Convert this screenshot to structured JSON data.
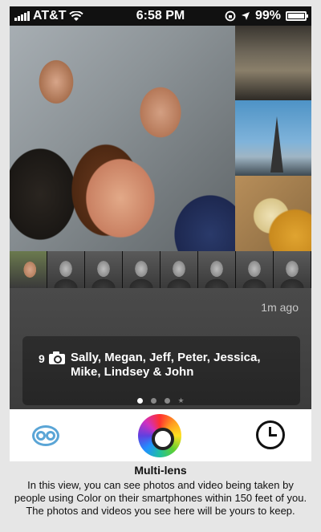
{
  "status_bar": {
    "carrier": "AT&T",
    "time": "6:58 PM",
    "battery": "99%",
    "battery_level": 0.99,
    "icons": [
      "signal-icon",
      "wifi-icon",
      "rotation-lock-icon",
      "location-arrow-icon",
      "battery-icon"
    ]
  },
  "photo_view": {
    "main_photo": "group-selfie-photo",
    "side_thumbnails": [
      "market-hall-photo",
      "transamerica-pyramid-photo",
      "cheese-wheels-photo"
    ],
    "people_strip_count": 9
  },
  "info": {
    "time_ago": "1m ago",
    "photo_count": "9",
    "names": "Sally, Megan, Jeff, Peter, Jessica, Mike, Lindsey & John",
    "page_dots": 4,
    "active_page": 1
  },
  "tab_bar": {
    "items": [
      "multi-lens-tab",
      "color-wheel-camera-tab",
      "history-clock-tab"
    ]
  },
  "caption": {
    "title": "Multi-lens",
    "line1": "In this view, you can see photos and video being taken by",
    "line2": "people using Color on their smartphones within 150 feet of you.",
    "line3": "The photos and videos you see here will be yours to keep."
  }
}
